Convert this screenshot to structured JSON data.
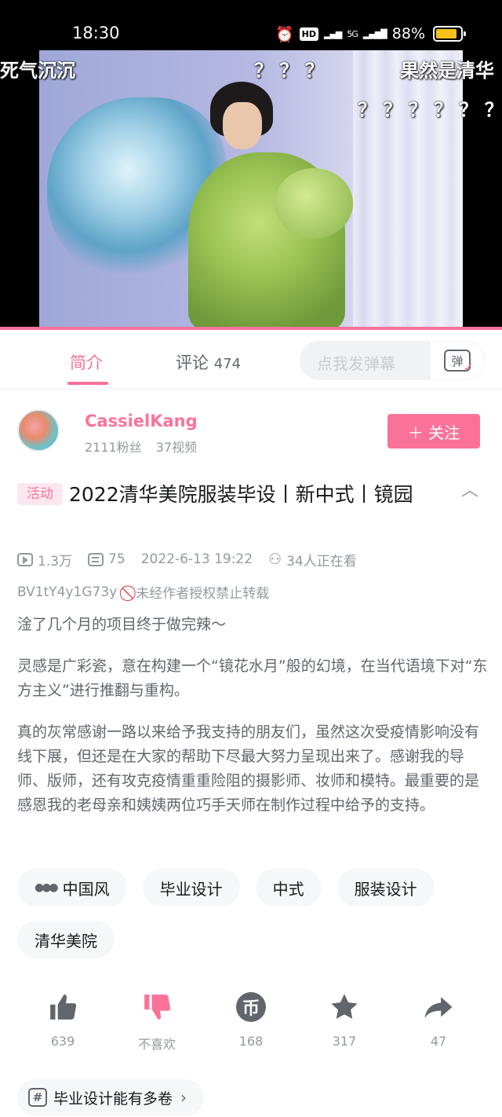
{
  "status_bar": {
    "time": "18:30",
    "hd": "HD",
    "network": "5G",
    "battery": "88%",
    "battery_level": 0.88
  },
  "video": {
    "danmaku": [
      {
        "text": "死气沉沉"
      },
      {
        "text": "？ ？ ？"
      },
      {
        "text": "果然是清华"
      },
      {
        "text": "？ ？ ？ ？ ？ ？ ？"
      }
    ],
    "progress": 1.0
  },
  "tabs": {
    "intro": "简介",
    "comments": "评论",
    "comment_count": "474"
  },
  "danmu_input": {
    "placeholder": "点我发弹幕",
    "button_glyph": "弹"
  },
  "author": {
    "name": "CassielKang",
    "fans": "2111粉丝",
    "videos": "37视频",
    "follow_label": "＋ 关注"
  },
  "video_info": {
    "activity_tag": "活动",
    "title": "2022清华美院服装毕设丨新中式丨镜园",
    "views": "1.3万",
    "danmaku_count": "75",
    "date": "2022-6-13 19:22",
    "watching": "34人正在看",
    "bvid": "BV1tY4y1G73y",
    "copyright": "未经作者授权禁止转载"
  },
  "description": [
    "淦了几个月的项目终于做完辣～",
    "灵感是广彩瓷，意在构建一个“镜花水月”般的幻境，在当代语境下对“东方主义”进行推翻与重构。",
    "真的灰常感谢一路以来给予我支持的朋友们，虽然这次受疫情影响没有线下展，但还是在大家的帮助下尽最大努力呈现出来了。感谢我的导师、版师，还有攻克疫情重重险阻的摄影师、妆师和模特。最重要的是感恩我的老母亲和姨姨两位巧手天师在制作过程中给予的支持。"
  ],
  "tags": [
    "中国风",
    "毕业设计",
    "中式",
    "服装设计",
    "清华美院"
  ],
  "actions": {
    "like": "639",
    "dislike": "不喜欢",
    "coin": "168",
    "coin_glyph": "币",
    "favorite": "317",
    "share": "47"
  },
  "colors": {
    "accent": "#fb7299",
    "text": "#18191c",
    "secondary": "#9499a0"
  },
  "topic": {
    "label": "毕业设计能有多卷"
  }
}
